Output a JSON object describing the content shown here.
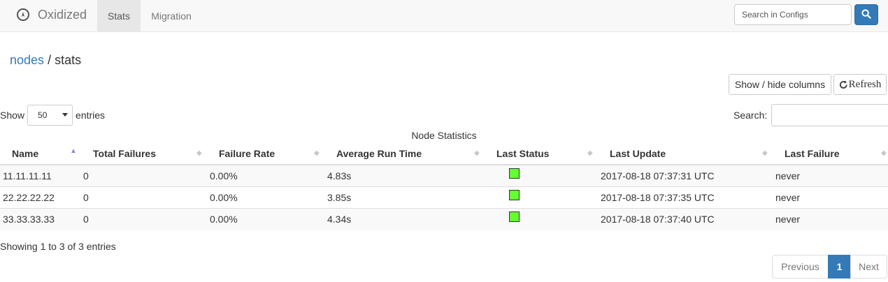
{
  "navbar": {
    "brand": "Oxidized",
    "tabs": [
      {
        "label": "Stats",
        "active": true
      },
      {
        "label": "Migration",
        "active": false
      }
    ],
    "search_placeholder": "Search in Configs",
    "accent_color": "#337ab7"
  },
  "breadcrumb": {
    "link": "nodes",
    "separator": "/",
    "current": "stats"
  },
  "toolbar": {
    "columns_label": "Show / hide columns",
    "refresh_label": "Refresh"
  },
  "length": {
    "prefix": "Show",
    "value": "50",
    "suffix": "entries"
  },
  "filter": {
    "label": "Search:",
    "value": ""
  },
  "table": {
    "caption": "Node Statistics",
    "columns": [
      "Name",
      "Total Failures",
      "Failure Rate",
      "Average Run Time",
      "Last Status",
      "Last Update",
      "Last Failure"
    ],
    "rows": [
      {
        "name": "11.11.11.11",
        "total_failures": "0",
        "failure_rate": "0.00%",
        "avg_run_time": "4.83s",
        "last_status": "success",
        "last_update": "2017-08-18 07:37:31 UTC",
        "last_failure": "never"
      },
      {
        "name": "22.22.22.22",
        "total_failures": "0",
        "failure_rate": "0.00%",
        "avg_run_time": "3.85s",
        "last_status": "success",
        "last_update": "2017-08-18 07:37:35 UTC",
        "last_failure": "never"
      },
      {
        "name": "33.33.33.33",
        "total_failures": "0",
        "failure_rate": "0.00%",
        "avg_run_time": "4.34s",
        "last_status": "success",
        "last_update": "2017-08-18 07:37:40 UTC",
        "last_failure": "never"
      }
    ],
    "status_color": "#66ff33"
  },
  "info": "Showing 1 to 3 of 3 entries",
  "pagination": {
    "previous": "Previous",
    "current": "1",
    "next": "Next"
  }
}
